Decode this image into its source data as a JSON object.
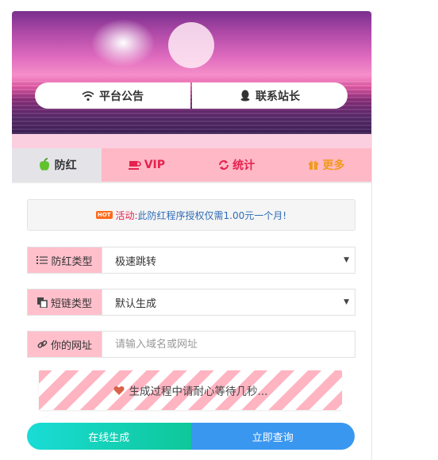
{
  "header": {
    "notice_button": "平台公告",
    "contact_button": "联系站长"
  },
  "tabs": [
    {
      "label": "防红",
      "icon": "apple-icon"
    },
    {
      "label": "VIP",
      "icon": "cup-icon"
    },
    {
      "label": "统计",
      "icon": "refresh-icon"
    },
    {
      "label": "更多",
      "icon": "gift-icon"
    }
  ],
  "notice": {
    "badge": "HOT",
    "label": "活动:",
    "text": "此防红程序授权仅需1.00元一个月!"
  },
  "form": {
    "protect_type_label": "防红类型",
    "protect_type_value": "极速跳转",
    "short_type_label": "短链类型",
    "short_type_value": "默认生成",
    "url_label": "你的网址",
    "url_placeholder": "请输入域名或网址"
  },
  "progress": {
    "text": "生成过程中请耐心等待几秒..."
  },
  "actions": {
    "generate": "在线生成",
    "query": "立即查询"
  },
  "colors": {
    "pink": "#ffc0cc",
    "vip_red": "#e5224e",
    "more_orange": "#f29a1c",
    "query_blue": "#3a97f0",
    "generate_green": "#0fc79a"
  }
}
